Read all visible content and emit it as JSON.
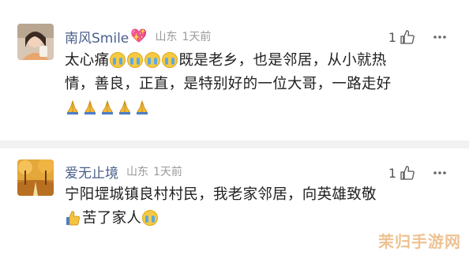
{
  "comments": [
    {
      "username": "南风Smile",
      "location": "山东",
      "time": "1天前",
      "likes": "1",
      "text_line1": "太心痛",
      "text_line1b": "既是老乡，也是邻居，从小就热",
      "text_line2": "情，善良，正直，是特别好的一位大哥，一路走好",
      "emoji_1": "loudly-crying-face",
      "emoji_2": "folded-hands"
    },
    {
      "username": "爱无止境",
      "location": "山东",
      "time": "1天前",
      "likes": "1",
      "text_line1": "宁阳堽城镇良村村民，我老家邻居，向英雄致敬",
      "text_line2": "苦了家人",
      "emoji_1": "thumbs-up",
      "emoji_2": "loudly-crying-face"
    }
  ],
  "watermark": "茉归手游网",
  "colors": {
    "username": "#4b5f8a",
    "meta": "#9a9a9a",
    "divider": "#f2f2f2"
  }
}
